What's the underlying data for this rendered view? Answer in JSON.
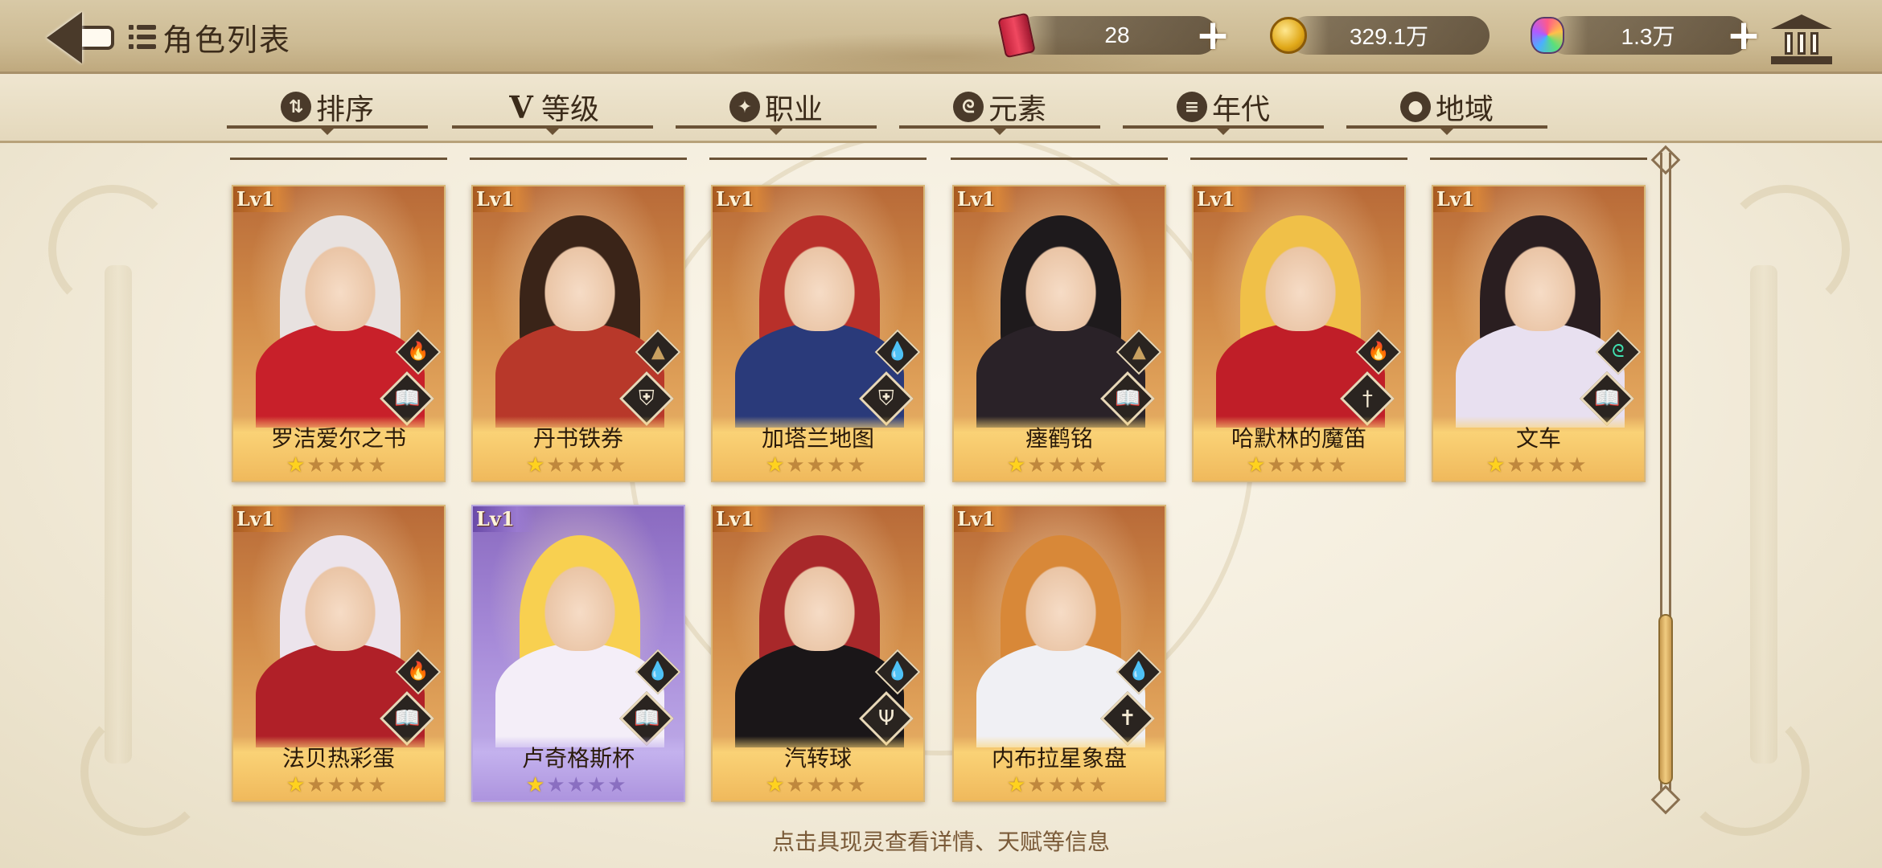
{
  "header": {
    "title": "角色列表",
    "currencies": [
      {
        "icon": "soda-can-icon",
        "value": "28"
      },
      {
        "icon": "gold-coin-icon",
        "value": "329.1万"
      },
      {
        "icon": "rainbow-gem-icon",
        "value": "1.3万"
      }
    ]
  },
  "tabs": [
    {
      "label": "排序",
      "icon": "sort-icon"
    },
    {
      "label": "等级",
      "icon": "level-v-icon"
    },
    {
      "label": "职业",
      "icon": "profession-icon"
    },
    {
      "label": "元素",
      "icon": "element-swirl-icon"
    },
    {
      "label": "年代",
      "icon": "era-icon"
    },
    {
      "label": "地域",
      "icon": "location-pin-icon"
    }
  ],
  "cards": [
    {
      "level": "Lv1",
      "name": "罗洁爱尔之书",
      "element": "fire",
      "class": "book",
      "stars": 1,
      "max_stars": 5,
      "rarity": "orange",
      "hair": "#e8e2e0",
      "outfit": "#c8202a"
    },
    {
      "level": "Lv1",
      "name": "丹书铁券",
      "element": "earth",
      "class": "shield",
      "stars": 1,
      "max_stars": 5,
      "rarity": "orange",
      "hair": "#3a2418",
      "outfit": "#b8382a"
    },
    {
      "level": "Lv1",
      "name": "加塔兰地图",
      "element": "water",
      "class": "shield",
      "stars": 1,
      "max_stars": 5,
      "rarity": "orange",
      "hair": "#b8302a",
      "outfit": "#2a3a7a"
    },
    {
      "level": "Lv1",
      "name": "瘗鹤铭",
      "element": "earth",
      "class": "book",
      "stars": 1,
      "max_stars": 5,
      "rarity": "orange",
      "hair": "#1e1a1c",
      "outfit": "#2a2228"
    },
    {
      "level": "Lv1",
      "name": "哈默林的魔笛",
      "element": "fire",
      "class": "sword",
      "stars": 1,
      "max_stars": 5,
      "rarity": "orange",
      "hair": "#f0c048",
      "outfit": "#c01e28"
    },
    {
      "level": "Lv1",
      "name": "文车",
      "element": "wind",
      "class": "book",
      "stars": 1,
      "max_stars": 5,
      "rarity": "orange",
      "hair": "#2a1e20",
      "outfit": "#e8e0f0"
    },
    {
      "level": "Lv1",
      "name": "法贝热彩蛋",
      "element": "fire",
      "class": "book",
      "stars": 1,
      "max_stars": 5,
      "rarity": "orange",
      "hair": "#ece4ec",
      "outfit": "#b02028"
    },
    {
      "level": "Lv1",
      "name": "卢奇格斯杯",
      "element": "water",
      "class": "book",
      "stars": 1,
      "max_stars": 5,
      "rarity": "purple",
      "hair": "#f8d050",
      "outfit": "#f4eef8"
    },
    {
      "level": "Lv1",
      "name": "汽转球",
      "element": "water",
      "class": "trident",
      "stars": 1,
      "max_stars": 5,
      "rarity": "orange",
      "hair": "#a8282a",
      "outfit": "#1a1618"
    },
    {
      "level": "Lv1",
      "name": "内布拉星象盘",
      "element": "water",
      "class": "cross",
      "stars": 1,
      "max_stars": 5,
      "rarity": "orange",
      "hair": "#d88838",
      "outfit": "#f0f0f4"
    }
  ],
  "hint": "点击具现灵查看详情、天赋等信息"
}
